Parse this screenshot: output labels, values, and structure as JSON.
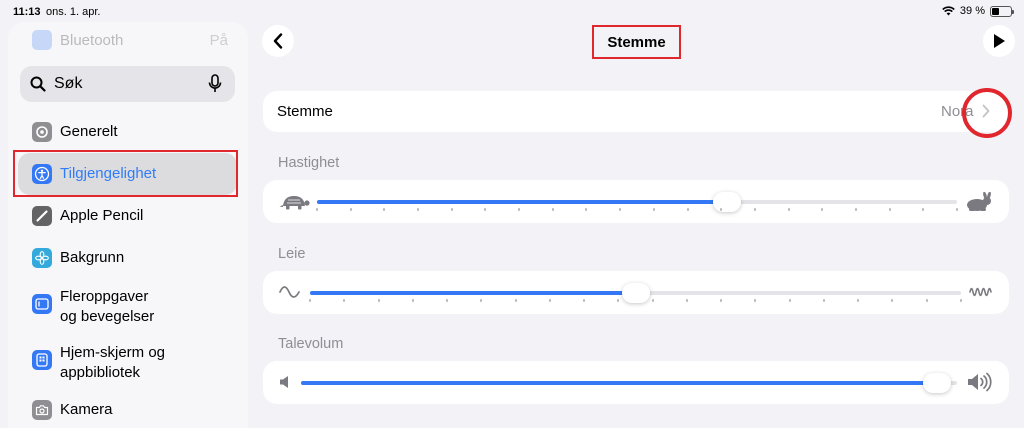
{
  "status_bar": {
    "time": "11:13",
    "date": "ons. 1. apr.",
    "battery_text": "39 %",
    "battery_level": 0.39
  },
  "sidebar": {
    "bluetooth": {
      "label": "Bluetooth",
      "value": "På"
    },
    "search": {
      "placeholder": "Søk"
    },
    "items": [
      {
        "label": "Generelt",
        "icon": "gear-icon",
        "color": "#8e8e93"
      },
      {
        "label": "Tilgjengelighet",
        "icon": "accessibility-icon",
        "color": "#3478f6",
        "selected": true
      },
      {
        "label": "Apple Pencil",
        "icon": "pencil-icon",
        "color": "#636366"
      },
      {
        "label": "Bakgrunn",
        "icon": "flower-icon",
        "color": "#34aadc"
      },
      {
        "label": "Fleroppgaver\nog bevegelser",
        "line1": "Fleroppgaver",
        "line2": "og bevegelser",
        "icon": "multitasking-icon",
        "color": "#3478f6"
      },
      {
        "label": "Hjem-skjerm og\nappbibliotek",
        "line1": "Hjem-skjerm og",
        "line2": "appbibliotek",
        "icon": "home-screen-icon",
        "color": "#3478f6"
      },
      {
        "label": "Kamera",
        "icon": "camera-icon",
        "color": "#8e8e93"
      }
    ]
  },
  "header": {
    "title": "Stemme",
    "back_icon": "chevron-left-icon",
    "play_icon": "play-icon"
  },
  "voice_row": {
    "label": "Stemme",
    "value": "Nora"
  },
  "sliders": [
    {
      "label": "Hastighet",
      "value": 0.64,
      "min_icon": "turtle-icon",
      "max_icon": "rabbit-icon"
    },
    {
      "label": "Leie",
      "value": 0.5,
      "min_icon": "low-wave-icon",
      "max_icon": "high-wave-icon"
    },
    {
      "label": "Talevolum",
      "value": 0.97,
      "min_icon": "speaker-low-icon",
      "max_icon": "speaker-high-icon"
    }
  ],
  "colors": {
    "accent": "#3478f6",
    "annotation": "#e0272e"
  }
}
